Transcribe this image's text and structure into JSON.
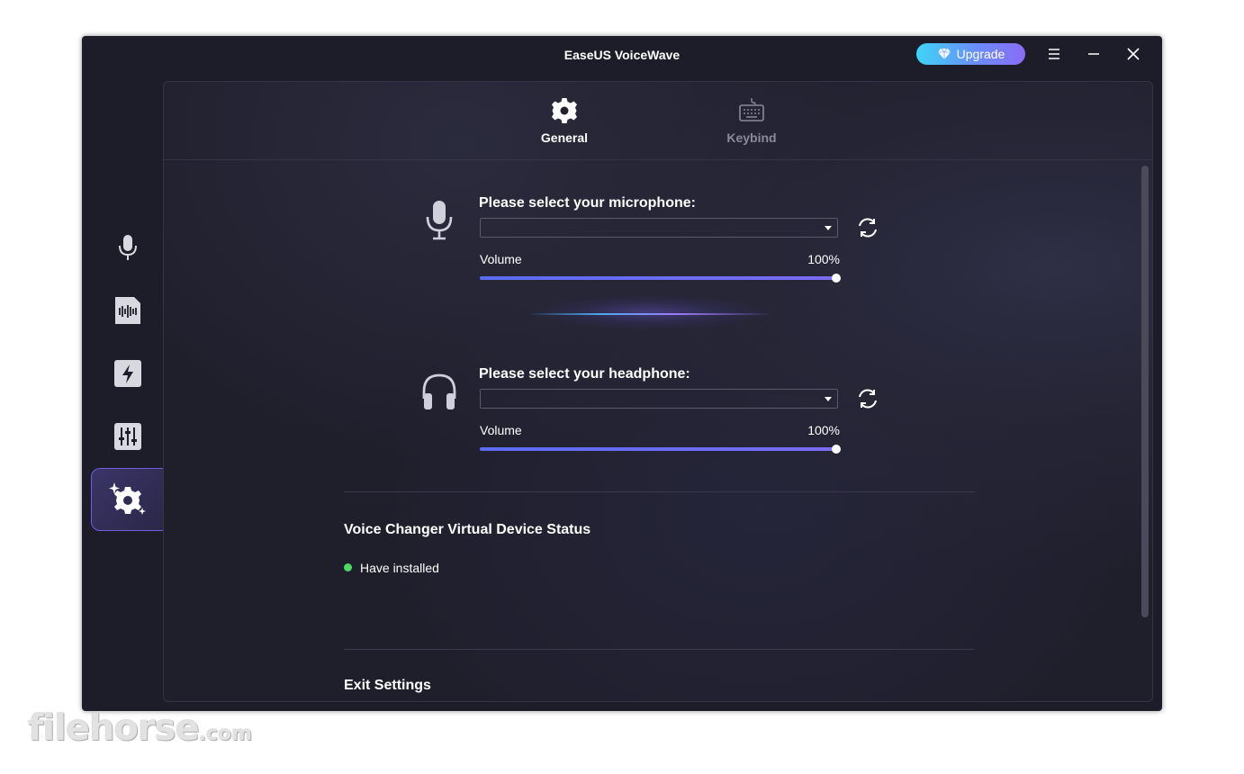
{
  "window": {
    "title": "EaseUS VoiceWave",
    "upgrade_label": "Upgrade"
  },
  "titlebar_icons": [
    "menu-icon",
    "minimize-icon",
    "close-icon"
  ],
  "sidebar": {
    "items": [
      {
        "name": "voice-changer",
        "icon": "microphone-icon",
        "active": false
      },
      {
        "name": "soundboard",
        "icon": "audio-file-icon",
        "active": false
      },
      {
        "name": "effects",
        "icon": "lightning-icon",
        "active": false
      },
      {
        "name": "mixer",
        "icon": "equalizer-icon",
        "active": false
      },
      {
        "name": "settings",
        "icon": "sparkle-gear-icon",
        "active": true
      }
    ]
  },
  "tabs": [
    {
      "label": "General",
      "icon": "gear-icon",
      "active": true
    },
    {
      "label": "Keybind",
      "icon": "keyboard-icon",
      "active": false
    }
  ],
  "microphone": {
    "label": "Please select your microphone:",
    "selected": "",
    "volume_label": "Volume",
    "volume_value": "100%",
    "volume_fraction": 1.0
  },
  "headphone": {
    "label": "Please select your headphone:",
    "selected": "",
    "volume_label": "Volume",
    "volume_value": "100%",
    "volume_fraction": 1.0
  },
  "device_status": {
    "title": "Voice Changer Virtual Device Status",
    "status_text": "Have installed",
    "status_color": "#4cd964"
  },
  "exit": {
    "title": "Exit Settings"
  },
  "colors": {
    "accent": "#6a6cf5",
    "active_tab": "#ffffff",
    "inactive_tab": "#8a8a98",
    "icon_light": "#d8d8e0"
  },
  "watermark": {
    "main": "filehorse",
    "suffix": ".com"
  }
}
